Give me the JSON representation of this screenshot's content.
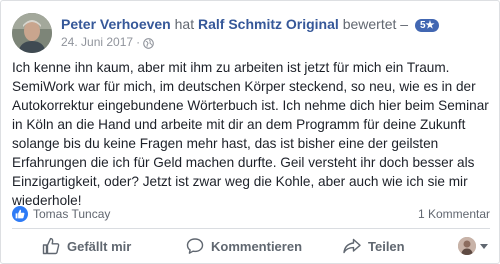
{
  "post": {
    "author": "Peter Verhoeven",
    "verb_has": "hat",
    "page": "Ralf Schmitz Original",
    "action_rated": "bewertet –",
    "rating": "5★",
    "date": "24. Juni 2017",
    "dot": "·",
    "audience_icon": "globe-icon",
    "text": "Ich kenne ihn kaum, aber mit ihm zu arbeiten ist jetzt für mich ein Traum. SemiWork war für mich, im deutschen Körper steckend, so neu, wie es in der Autokorrektur eingebundene Wörterbuch ist. Ich nehme dich hier beim Seminar in Köln an die Hand und arbeite mit dir an dem Programm für deine Zukunft solange bis du keine Fragen mehr hast, das ist bisher eine der geilsten Erfahrungen die ich für Geld machen durfte. Geil versteht ihr doch besser als Einzigartigkeit, oder? Jetzt ist zwar weg die Kohle, aber auch wie ich sie mir wiederhole!"
  },
  "reactions": {
    "icon": "like-icon",
    "liker": "Tomas Tuncay",
    "comment_count": "1 Kommentar"
  },
  "actions": {
    "like": "Gefällt mir",
    "comment": "Kommentieren",
    "share": "Teilen"
  },
  "colors": {
    "link": "#365899",
    "accent": "#4267b2",
    "like_blue": "#2e7bf6",
    "muted": "#616770"
  }
}
